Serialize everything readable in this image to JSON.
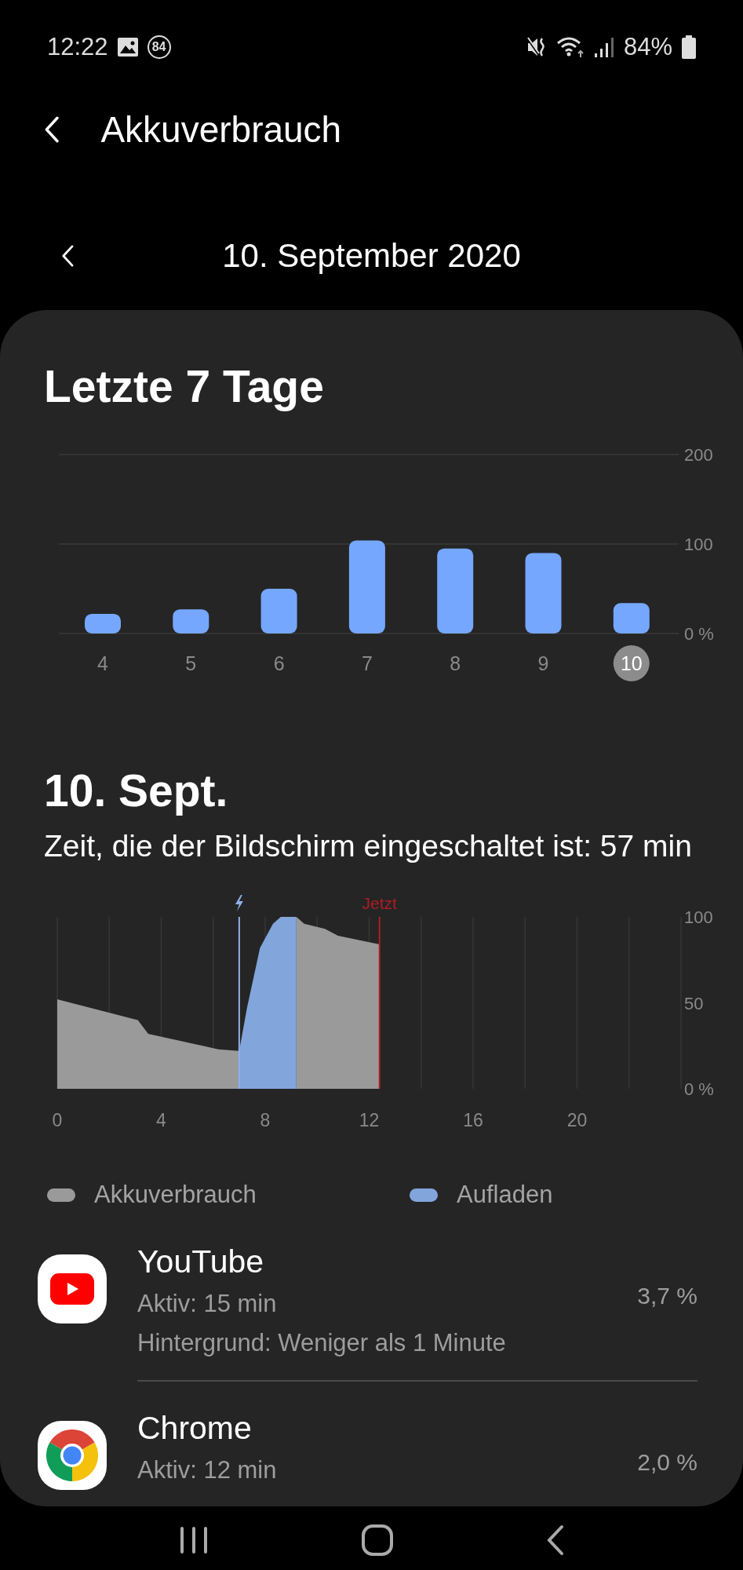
{
  "status_bar": {
    "time": "12:22",
    "badge": "84",
    "battery": "84%"
  },
  "app_bar": {
    "title": "Akkuverbrauch"
  },
  "date_nav": {
    "date": "10. September 2020"
  },
  "week": {
    "title": "Letzte 7 Tage",
    "days": [
      {
        "selected": false
      },
      {
        "selected": false
      },
      {
        "selected": false
      },
      {
        "selected": false
      },
      {
        "selected": false
      },
      {
        "selected": false
      },
      {
        "selected": true
      }
    ],
    "chart_data": {
      "type": "bar",
      "categories": [
        "4",
        "5",
        "6",
        "7",
        "8",
        "9",
        "10"
      ],
      "values": [
        22,
        27,
        50,
        104,
        95,
        90,
        34
      ],
      "ylim": [
        0,
        200
      ],
      "yticks": [
        {
          "value": 0,
          "label": "0 %"
        },
        100,
        200
      ]
    }
  },
  "day": {
    "title": "10. Sept.",
    "screen_time": "Zeit, die der Bildschirm eingeschaltet ist: 57 min",
    "chart_data": {
      "type": "area",
      "x": [
        0,
        3.1,
        3.5,
        6.2,
        7.0,
        7.3,
        7.8,
        8.3,
        8.6,
        9.2,
        9.5,
        10.3,
        10.8,
        12.4
      ],
      "series": [
        {
          "name": "Akkuverbrauch",
          "color": "#9a9a9a",
          "values": [
            52,
            40,
            32,
            23,
            22,
            null,
            null,
            null,
            null,
            100,
            96,
            93,
            89,
            84
          ]
        },
        {
          "name": "Aufladen",
          "color": "#82a5dc",
          "values": [
            null,
            null,
            null,
            null,
            22,
            47,
            82,
            96,
            100,
            100,
            null,
            null,
            null,
            null
          ]
        }
      ],
      "xlim": [
        0,
        24
      ],
      "ylim": [
        0,
        100
      ],
      "xticks": [
        0,
        4,
        8,
        12,
        16,
        20
      ],
      "yticks": [
        {
          "value": 0,
          "label": "0 %"
        },
        50,
        100
      ],
      "grid": true,
      "ref_lines": [
        {
          "axis": "x",
          "value": 7,
          "color": "#8fb0e8"
        },
        {
          "axis": "x",
          "value": 12.4,
          "label": "Jetzt",
          "color": "#b01c25"
        }
      ]
    }
  },
  "apps": [
    {
      "name": "YouTube",
      "active": "Aktiv: 15 min",
      "background": "Hintergrund: Weniger als 1 Minute",
      "usage": "3,7 %"
    },
    {
      "name": "Chrome",
      "active": "Aktiv: 12 min",
      "usage": "2,0 %"
    }
  ]
}
